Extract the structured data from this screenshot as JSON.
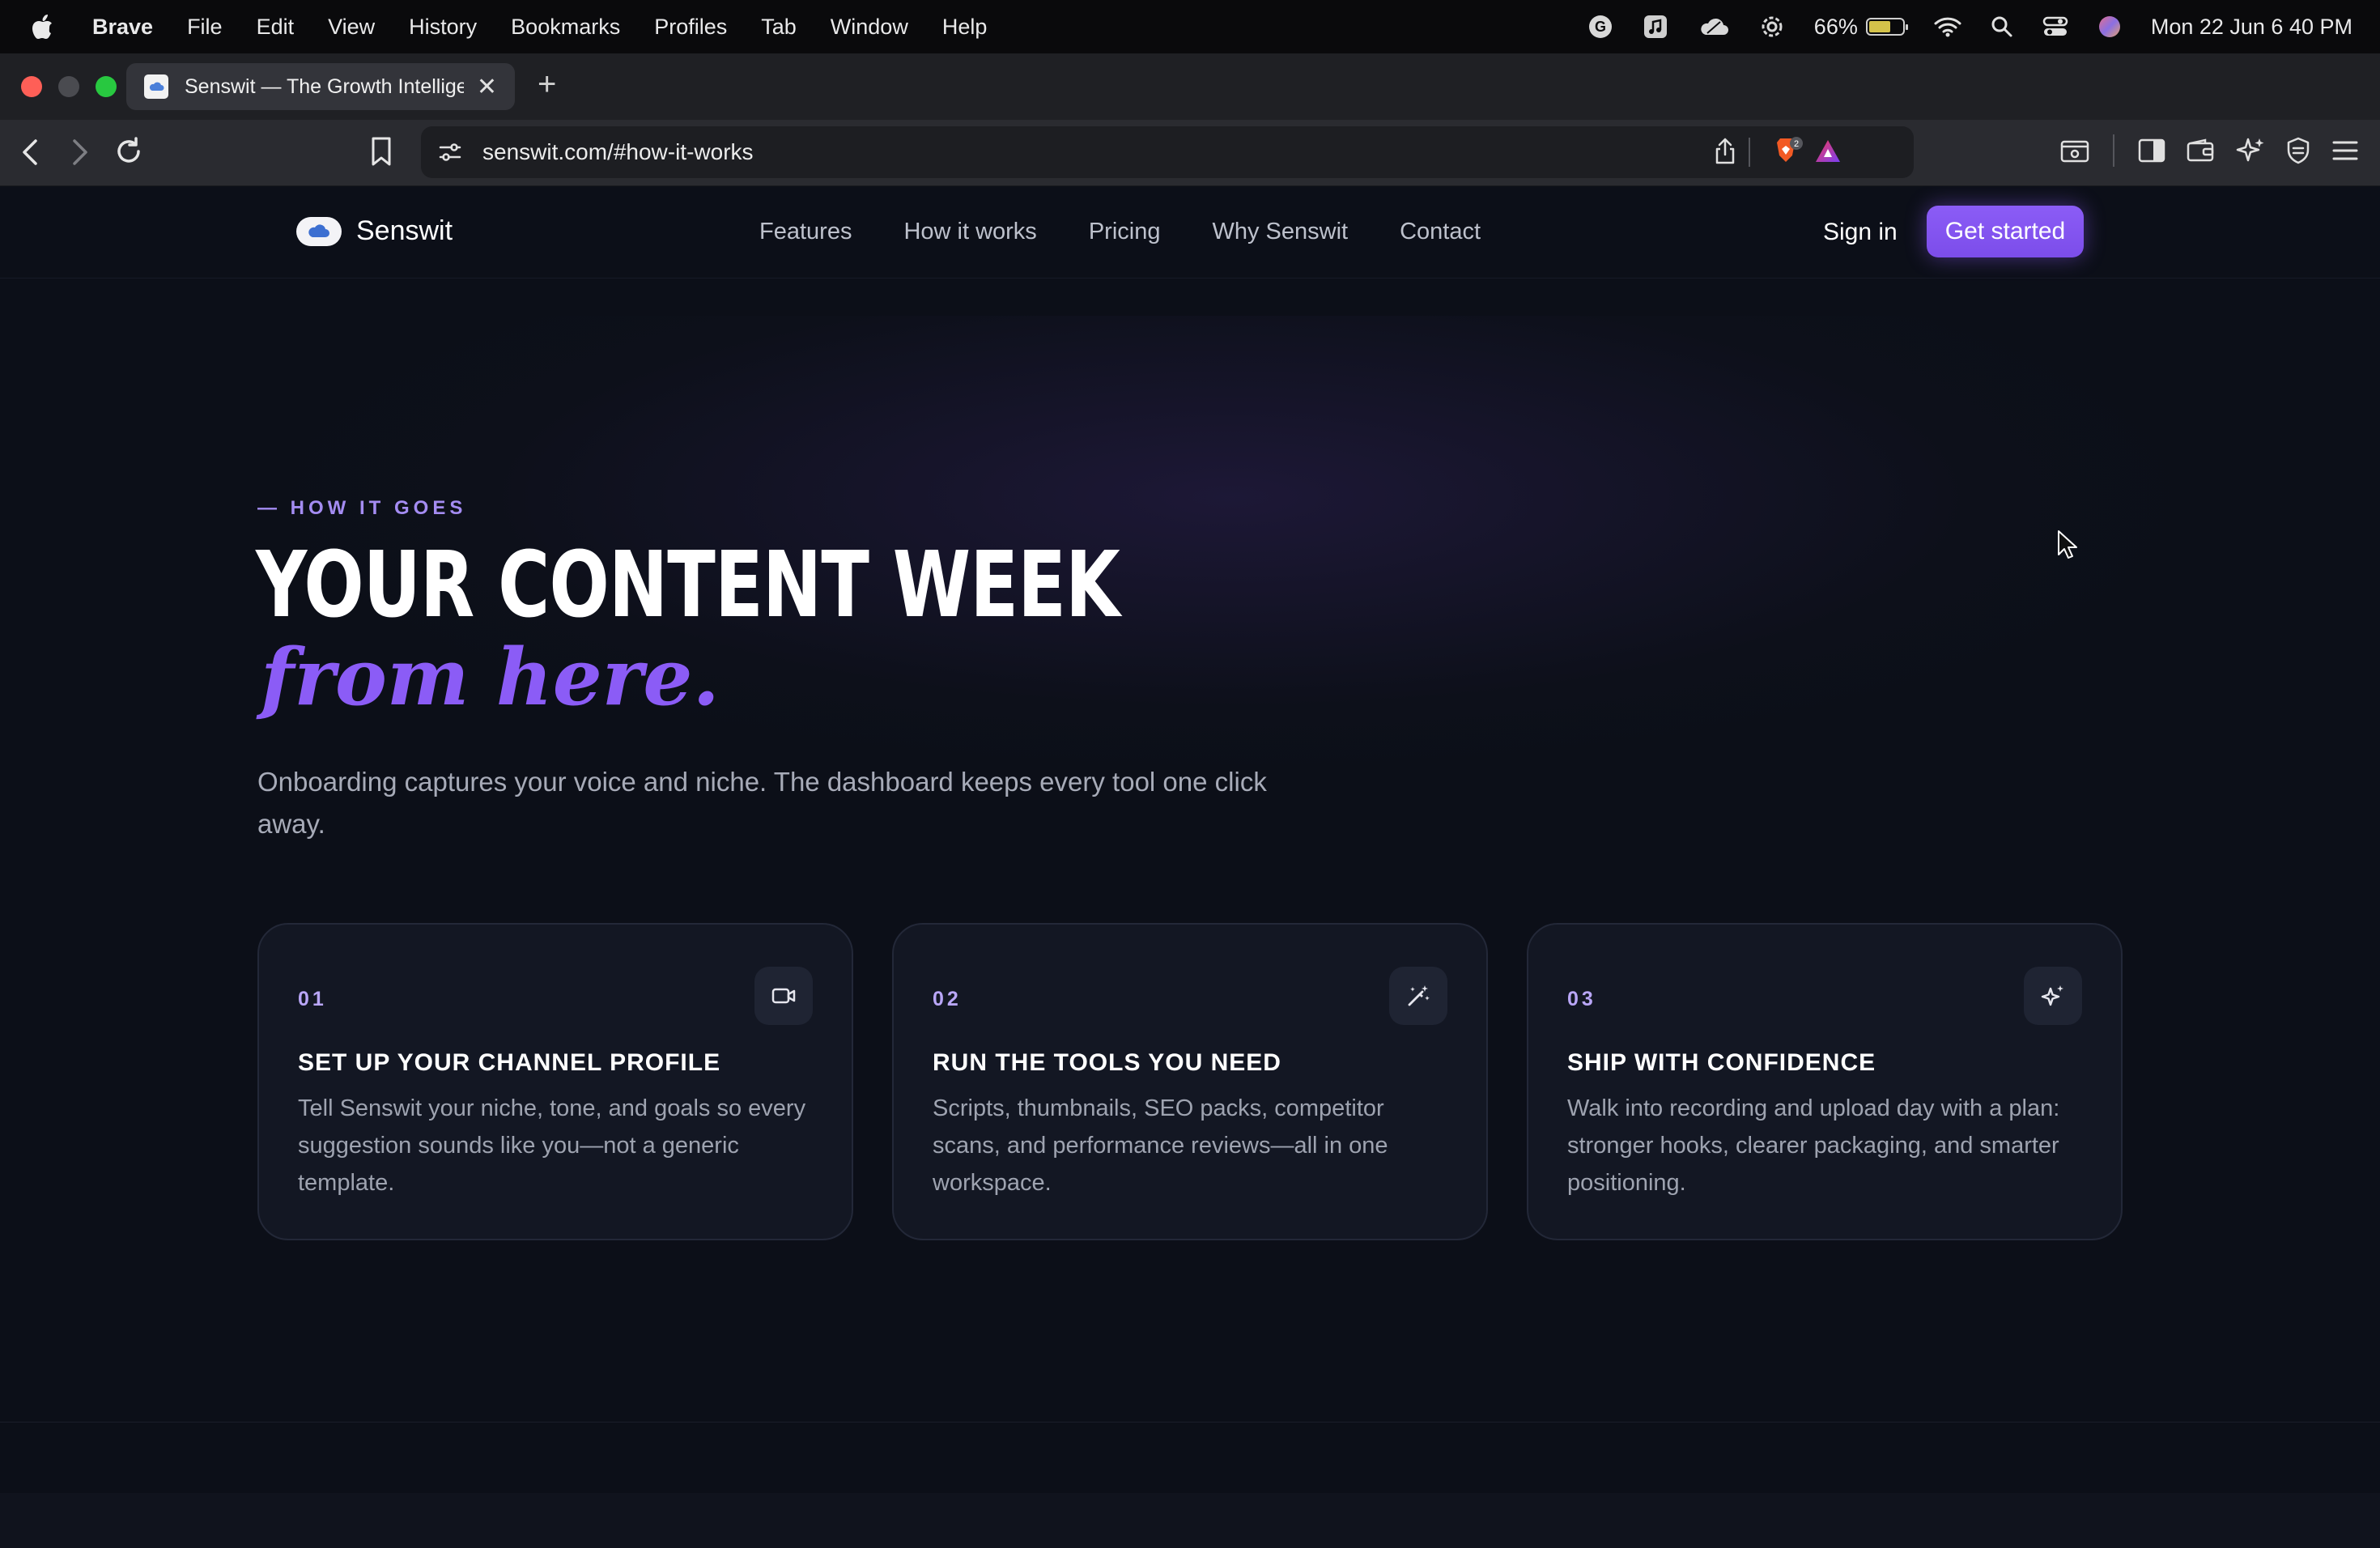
{
  "menubar": {
    "app_name": "Brave",
    "menus": [
      "File",
      "Edit",
      "View",
      "History",
      "Bookmarks",
      "Profiles",
      "Tab",
      "Window",
      "Help"
    ],
    "battery_percent": "66%",
    "battery_level": 0.66,
    "datetime": "Mon 22 Jun  6 40 PM",
    "status_icons": [
      "grammarly-icon",
      "music-icon",
      "cloud-icon",
      "gear-icon",
      "battery-icon",
      "wifi-icon",
      "spotlight-search-icon",
      "control-center-icon",
      "siri-icon"
    ]
  },
  "browser": {
    "tab_title": "Senswit — The Growth Intellige",
    "new_tab_symbol": "+",
    "close_symbol": "✕",
    "url": "senswit.com/#how-it-works",
    "shields_badge": "2"
  },
  "site": {
    "brand": "Senswit",
    "nav": [
      "Features",
      "How it works",
      "Pricing",
      "Why Senswit",
      "Contact"
    ],
    "signin": "Sign in",
    "cta": "Get started",
    "eyebrow": "— HOW IT GOES",
    "headline": "YOUR CONTENT WEEK",
    "headline_script": "from here.",
    "lede": "Onboarding captures your voice and niche. The dashboard keeps every tool one click away.",
    "accent_color": "#8b5cf6",
    "steps": [
      {
        "num": "01",
        "icon": "video-camera-icon",
        "title": "SET UP YOUR CHANNEL PROFILE",
        "desc": "Tell Senswit your niche, tone, and goals so every suggestion sounds like you—not a generic template."
      },
      {
        "num": "02",
        "icon": "magic-wand-icon",
        "title": "RUN THE TOOLS YOU NEED",
        "desc": "Scripts, thumbnails, SEO packs, competitor scans, and performance reviews—all in one workspace."
      },
      {
        "num": "03",
        "icon": "sparkles-icon",
        "title": "SHIP WITH CONFIDENCE",
        "desc": "Walk into recording and upload day with a plan: stronger hooks, clearer packaging, and smarter positioning."
      }
    ]
  }
}
